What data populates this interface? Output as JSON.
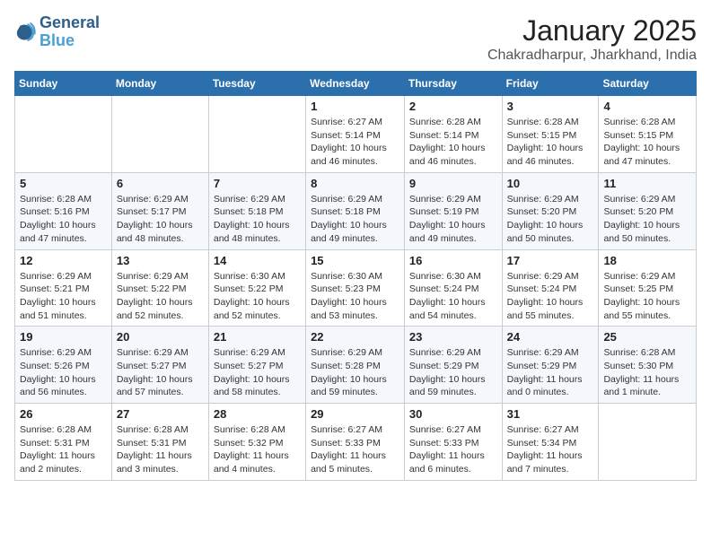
{
  "logo": {
    "line1": "General",
    "line2": "Blue"
  },
  "title": "January 2025",
  "subtitle": "Chakradharpur, Jharkhand, India",
  "days_of_week": [
    "Sunday",
    "Monday",
    "Tuesday",
    "Wednesday",
    "Thursday",
    "Friday",
    "Saturday"
  ],
  "weeks": [
    [
      {
        "day": "",
        "content": ""
      },
      {
        "day": "",
        "content": ""
      },
      {
        "day": "",
        "content": ""
      },
      {
        "day": "1",
        "content": "Sunrise: 6:27 AM\nSunset: 5:14 PM\nDaylight: 10 hours\nand 46 minutes."
      },
      {
        "day": "2",
        "content": "Sunrise: 6:28 AM\nSunset: 5:14 PM\nDaylight: 10 hours\nand 46 minutes."
      },
      {
        "day": "3",
        "content": "Sunrise: 6:28 AM\nSunset: 5:15 PM\nDaylight: 10 hours\nand 46 minutes."
      },
      {
        "day": "4",
        "content": "Sunrise: 6:28 AM\nSunset: 5:15 PM\nDaylight: 10 hours\nand 47 minutes."
      }
    ],
    [
      {
        "day": "5",
        "content": "Sunrise: 6:28 AM\nSunset: 5:16 PM\nDaylight: 10 hours\nand 47 minutes."
      },
      {
        "day": "6",
        "content": "Sunrise: 6:29 AM\nSunset: 5:17 PM\nDaylight: 10 hours\nand 48 minutes."
      },
      {
        "day": "7",
        "content": "Sunrise: 6:29 AM\nSunset: 5:18 PM\nDaylight: 10 hours\nand 48 minutes."
      },
      {
        "day": "8",
        "content": "Sunrise: 6:29 AM\nSunset: 5:18 PM\nDaylight: 10 hours\nand 49 minutes."
      },
      {
        "day": "9",
        "content": "Sunrise: 6:29 AM\nSunset: 5:19 PM\nDaylight: 10 hours\nand 49 minutes."
      },
      {
        "day": "10",
        "content": "Sunrise: 6:29 AM\nSunset: 5:20 PM\nDaylight: 10 hours\nand 50 minutes."
      },
      {
        "day": "11",
        "content": "Sunrise: 6:29 AM\nSunset: 5:20 PM\nDaylight: 10 hours\nand 50 minutes."
      }
    ],
    [
      {
        "day": "12",
        "content": "Sunrise: 6:29 AM\nSunset: 5:21 PM\nDaylight: 10 hours\nand 51 minutes."
      },
      {
        "day": "13",
        "content": "Sunrise: 6:29 AM\nSunset: 5:22 PM\nDaylight: 10 hours\nand 52 minutes."
      },
      {
        "day": "14",
        "content": "Sunrise: 6:30 AM\nSunset: 5:22 PM\nDaylight: 10 hours\nand 52 minutes."
      },
      {
        "day": "15",
        "content": "Sunrise: 6:30 AM\nSunset: 5:23 PM\nDaylight: 10 hours\nand 53 minutes."
      },
      {
        "day": "16",
        "content": "Sunrise: 6:30 AM\nSunset: 5:24 PM\nDaylight: 10 hours\nand 54 minutes."
      },
      {
        "day": "17",
        "content": "Sunrise: 6:29 AM\nSunset: 5:24 PM\nDaylight: 10 hours\nand 55 minutes."
      },
      {
        "day": "18",
        "content": "Sunrise: 6:29 AM\nSunset: 5:25 PM\nDaylight: 10 hours\nand 55 minutes."
      }
    ],
    [
      {
        "day": "19",
        "content": "Sunrise: 6:29 AM\nSunset: 5:26 PM\nDaylight: 10 hours\nand 56 minutes."
      },
      {
        "day": "20",
        "content": "Sunrise: 6:29 AM\nSunset: 5:27 PM\nDaylight: 10 hours\nand 57 minutes."
      },
      {
        "day": "21",
        "content": "Sunrise: 6:29 AM\nSunset: 5:27 PM\nDaylight: 10 hours\nand 58 minutes."
      },
      {
        "day": "22",
        "content": "Sunrise: 6:29 AM\nSunset: 5:28 PM\nDaylight: 10 hours\nand 59 minutes."
      },
      {
        "day": "23",
        "content": "Sunrise: 6:29 AM\nSunset: 5:29 PM\nDaylight: 10 hours\nand 59 minutes."
      },
      {
        "day": "24",
        "content": "Sunrise: 6:29 AM\nSunset: 5:29 PM\nDaylight: 11 hours\nand 0 minutes."
      },
      {
        "day": "25",
        "content": "Sunrise: 6:28 AM\nSunset: 5:30 PM\nDaylight: 11 hours\nand 1 minute."
      }
    ],
    [
      {
        "day": "26",
        "content": "Sunrise: 6:28 AM\nSunset: 5:31 PM\nDaylight: 11 hours\nand 2 minutes."
      },
      {
        "day": "27",
        "content": "Sunrise: 6:28 AM\nSunset: 5:31 PM\nDaylight: 11 hours\nand 3 minutes."
      },
      {
        "day": "28",
        "content": "Sunrise: 6:28 AM\nSunset: 5:32 PM\nDaylight: 11 hours\nand 4 minutes."
      },
      {
        "day": "29",
        "content": "Sunrise: 6:27 AM\nSunset: 5:33 PM\nDaylight: 11 hours\nand 5 minutes."
      },
      {
        "day": "30",
        "content": "Sunrise: 6:27 AM\nSunset: 5:33 PM\nDaylight: 11 hours\nand 6 minutes."
      },
      {
        "day": "31",
        "content": "Sunrise: 6:27 AM\nSunset: 5:34 PM\nDaylight: 11 hours\nand 7 minutes."
      },
      {
        "day": "",
        "content": ""
      }
    ]
  ]
}
